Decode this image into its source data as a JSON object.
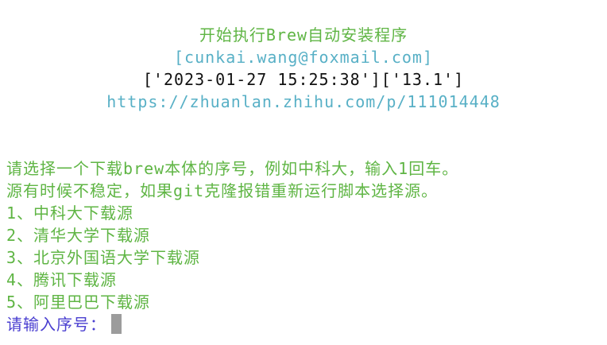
{
  "header": {
    "title": "开始执行Brew自动安装程序",
    "email": "[cunkai.wang@foxmail.com]",
    "datetime": "['2023-01-27 15:25:38']['13.1']",
    "url": "https://zhuanlan.zhihu.com/p/111014448"
  },
  "instructions": {
    "line1": "请选择一个下载brew本体的序号，例如中科大，输入1回车。",
    "line2": "源有时候不稳定，如果git克隆报错重新运行脚本选择源。"
  },
  "options": [
    {
      "label": "1、中科大下载源"
    },
    {
      "label": "2、清华大学下载源"
    },
    {
      "label": "3、北京外国语大学下载源"
    },
    {
      "label": "4、腾讯下载源"
    },
    {
      "label": "5、阿里巴巴下载源"
    }
  ],
  "prompt": {
    "label": "请输入序号：",
    "value": ""
  },
  "colors": {
    "green": "#5fb544",
    "cyan": "#58b0c6",
    "black": "#111111",
    "blue": "#4a3fd0",
    "cursor": "#9c9c9c"
  }
}
